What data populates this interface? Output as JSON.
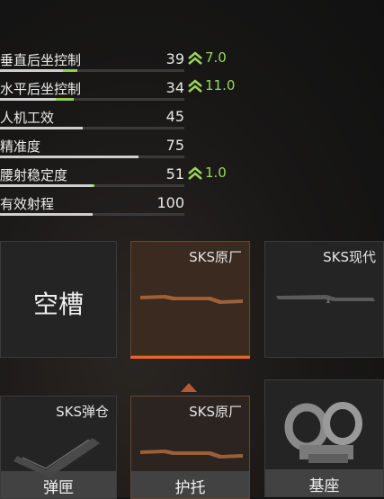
{
  "stats": [
    {
      "label": "垂直后坐控制",
      "value": "39",
      "fill": 0.34,
      "gain": 0.08,
      "bonus": "7.0"
    },
    {
      "label": "水平后坐控制",
      "value": "34",
      "fill": 0.3,
      "gain": 0.1,
      "bonus": "11.0"
    },
    {
      "label": "人机工效",
      "value": "45",
      "fill": 0.45,
      "gain": 0,
      "bonus": ""
    },
    {
      "label": "精准度",
      "value": "75",
      "fill": 0.75,
      "gain": 0,
      "bonus": ""
    },
    {
      "label": "腰射稳定度",
      "value": "51",
      "fill": 0.5,
      "gain": 0.01,
      "bonus": "1.0"
    },
    {
      "label": "有效射程",
      "value": "100",
      "fill": 0.5,
      "gain": 0,
      "bonus": ""
    }
  ],
  "cards": {
    "empty_label": "空槽",
    "stock_original": "SKS原厂",
    "stock_modern": "SKS现代",
    "magazine": "SKS弹仓",
    "handguard_original": "SKS原厂",
    "footer_magazine": "弹匣",
    "footer_handguard": "护托",
    "footer_mount": "基座"
  },
  "colors": {
    "accent": "#e2662a",
    "bonus": "#9ad65a"
  }
}
